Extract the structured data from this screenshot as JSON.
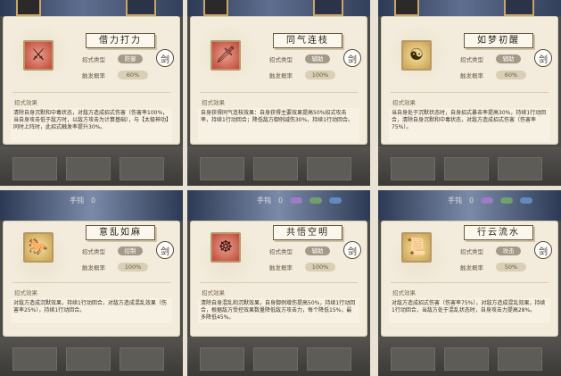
{
  "labels": {
    "stance_type": "招式类型",
    "trigger_rate": "触发概率",
    "effect": "招式效果",
    "sword_glyph": "剑"
  },
  "top_counter": {
    "label": "手钝",
    "value": "0"
  },
  "cards": [
    {
      "title": "借力打力",
      "icon": "warrior-figure-icon",
      "icon_color": "#c0473c",
      "type": "防御",
      "rate": "60%",
      "desc": "清除自身沉默和中毒状态，对敌方造成招式伤害（伤害率100%，当自身攻击低于敌方时，以敌方攻击为计算基础），与【太极神功】同时上阵时，此招式触发率提升30%。"
    },
    {
      "title": "同气连枝",
      "icon": "sword-icon",
      "icon_color": "#c0473c",
      "type": "辅助",
      "rate": "100%",
      "desc": "自身获得同气连枝效果：自身获得主要效果提高50%招式攻击率，持续1行动回合；降低敌方御例减伤30%，持续1行动回合。"
    },
    {
      "title": "如梦初醒",
      "icon": "meditating-figure-icon",
      "icon_color": "#caa050",
      "type": "辅助",
      "rate": "60%",
      "desc": "当自身处于沉默状态时，自身招式暴击率提高30%，持续1行动回合，清除自身沉默和中毒状态，对敌方造成招式伤害（伤害率75%）。"
    },
    {
      "title": "意乱如麻",
      "icon": "beast-icon",
      "icon_color": "#caa050",
      "type": "控制",
      "rate": "100%",
      "desc": "对敌方造成沉默效果，持续1行动回合，对敌方造成混乱效果（伤害率25%），持续1行动回合。"
    },
    {
      "title": "共悟空明",
      "icon": "monk-figure-icon",
      "icon_color": "#c0473c",
      "type": "辅助",
      "rate": "100%",
      "desc": "清除自身混乱和沉默效果，自身御例增伤提高50%，持续1行动回合，根据敌方受控效果数量降低敌方攻击力，每个降低15%，最多降低45%。"
    },
    {
      "title": "行云流水",
      "icon": "scroll-icon",
      "icon_color": "#caa050",
      "type": "攻击",
      "rate": "50%",
      "desc": "对敌方造成招式伤害（伤害率75%），对敌方造成混乱效果，持续1行动回合，当敌方处于混乱状态时，自身攻击力提高28%。"
    }
  ]
}
